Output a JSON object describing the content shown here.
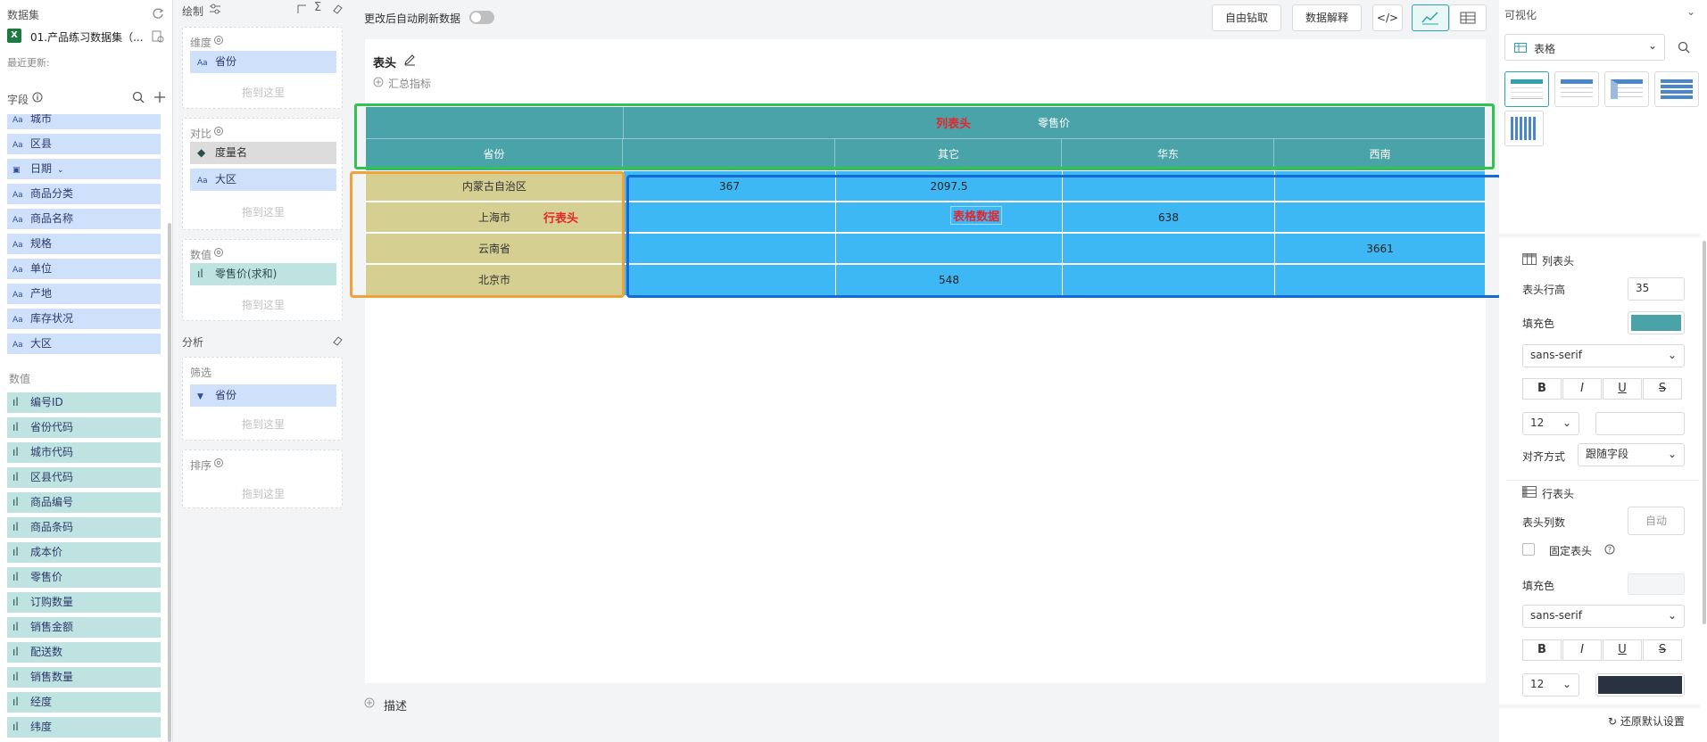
{
  "dataset": {
    "title": "数据集",
    "name": "01.产品练习数据集（...",
    "updated": "最近更新:"
  },
  "fields": {
    "title": "字段",
    "dims": [
      "城市",
      "区县",
      "日期",
      "商品分类",
      "商品名称",
      "规格",
      "单位",
      "产地",
      "库存状况",
      "大区"
    ],
    "measures_title": "数值",
    "measures": [
      "编号ID",
      "省份代码",
      "城市代码",
      "区县代码",
      "商品编号",
      "商品条码",
      "成本价",
      "零售价",
      "订购数量",
      "销售金额",
      "配送数",
      "销售数量",
      "经度",
      "纬度"
    ]
  },
  "draw": {
    "title": "绘制",
    "dimension": {
      "title": "维度",
      "items": [
        "省份"
      ],
      "drop": "拖到这里"
    },
    "compare": {
      "title": "对比",
      "items": [
        "度量名",
        "大区"
      ],
      "drop": "拖到这里"
    },
    "values": {
      "title": "数值",
      "items": [
        "零售价(求和)"
      ],
      "drop": "拖到这里"
    },
    "analysis": {
      "title": "分析"
    },
    "filter": {
      "title": "筛选",
      "items": [
        "省份"
      ],
      "drop": "拖到这里"
    },
    "sort": {
      "title": "排序",
      "drop": "拖到这里"
    }
  },
  "toolbar": {
    "auto_refresh": "更改后自动刷新数据",
    "drill": "自由钻取",
    "explain": "数据解释"
  },
  "canvas": {
    "title": "表头",
    "summary": "汇总指标",
    "describe": "描述",
    "annotations": {
      "col_header": "列表头",
      "row_header": "行表头",
      "table_data": "表格数据"
    }
  },
  "table": {
    "measure_header": "零售价",
    "row_dim_header": "省份",
    "col_headers": [
      "",
      "其它",
      "华东",
      "西南"
    ],
    "rows": [
      {
        "name": "内蒙古自治区",
        "cells": [
          "367",
          "2097.5",
          "",
          ""
        ]
      },
      {
        "name": "上海市",
        "cells": [
          "",
          "",
          "638",
          ""
        ]
      },
      {
        "name": "云南省",
        "cells": [
          "",
          "",
          "",
          "3661"
        ]
      },
      {
        "name": "北京市",
        "cells": [
          "",
          "548",
          "",
          ""
        ]
      }
    ]
  },
  "right": {
    "title": "可视化",
    "chart_type": "表格",
    "col_header": {
      "title": "列表头",
      "row_height_label": "表头行高",
      "row_height": "35",
      "fill_label": "填充色",
      "font": "sans-serif",
      "size": "12",
      "align_label": "对齐方式",
      "align": "跟随字段"
    },
    "row_header": {
      "title": "行表头",
      "col_count_label": "表头列数",
      "col_count": "自动",
      "fix_label": "固定表头",
      "fill_label": "填充色",
      "font": "sans-serif",
      "size": "12"
    },
    "reset": "还原默认设置"
  },
  "colors": {
    "header": "#4aa3a8",
    "row_header": "#d6cf92",
    "data": "#3db8f5",
    "green_box": "#2ec44f",
    "orange_box": "#f0a23a",
    "blue_box": "#1769d6",
    "annot": "#e8242b"
  }
}
